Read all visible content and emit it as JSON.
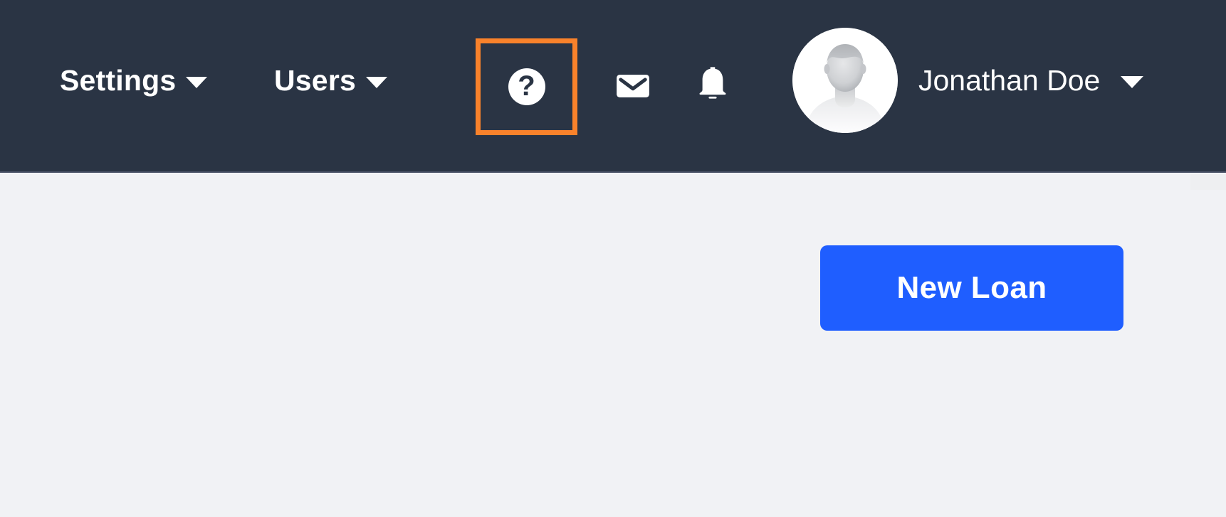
{
  "theme": {
    "header_bg": "#2a3444",
    "page_bg": "#f1f2f5",
    "accent_blue": "#1f5eff",
    "highlight_orange": "#f9822b",
    "text_light": "#ffffff"
  },
  "header": {
    "nav": [
      {
        "label": "Settings",
        "icon": "chevron-down-icon",
        "has_caret": true
      },
      {
        "label": "Users",
        "icon": "chevron-down-icon",
        "has_caret": true
      }
    ],
    "actions": [
      {
        "name": "help-icon",
        "glyph": "?",
        "highlighted": true
      },
      {
        "name": "mail-icon",
        "glyph": "envelope",
        "highlighted": false
      },
      {
        "name": "bell-icon",
        "glyph": "bell",
        "highlighted": false
      }
    ],
    "user": {
      "name": "Jonathan Doe",
      "avatar": "default-person-avatar",
      "caret": "chevron-down-icon"
    }
  },
  "main": {
    "primary_action": {
      "label": "New Loan"
    }
  }
}
